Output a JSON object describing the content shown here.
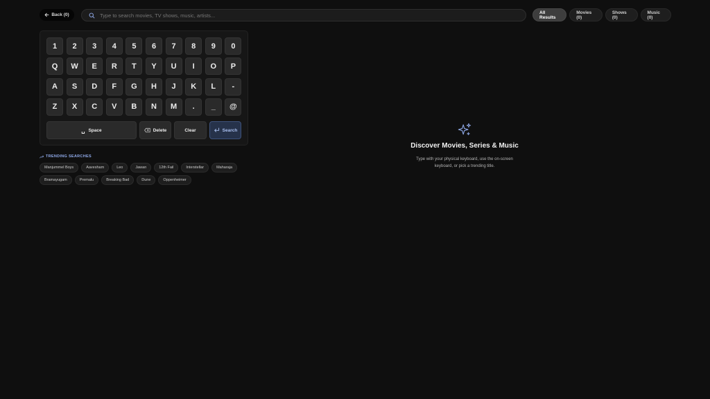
{
  "header": {
    "back_label": "Back (0)",
    "search_placeholder": "Type to search movies, TV shows, music, artists...",
    "search_value": "",
    "filters": [
      {
        "label": "All Results",
        "active": true
      },
      {
        "label": "Movies (0)",
        "active": false
      },
      {
        "label": "Shows (0)",
        "active": false
      },
      {
        "label": "Music (0)",
        "active": false
      }
    ]
  },
  "keyboard": {
    "rows": [
      [
        "1",
        "2",
        "3",
        "4",
        "5",
        "6",
        "7",
        "8",
        "9",
        "0"
      ],
      [
        "Q",
        "W",
        "E",
        "R",
        "T",
        "Y",
        "U",
        "I",
        "O",
        "P"
      ],
      [
        "A",
        "S",
        "D",
        "F",
        "G",
        "H",
        "J",
        "K",
        "L",
        "-"
      ],
      [
        "Z",
        "X",
        "C",
        "V",
        "B",
        "N",
        "M",
        ".",
        "_",
        "@"
      ]
    ],
    "space_label": "Space",
    "delete_label": "Delete",
    "clear_label": "Clear",
    "search_label": "Search"
  },
  "trending": {
    "title": "TRENDING SEARCHES",
    "items": [
      "Manjummel Boys",
      "Aavesham",
      "Leo",
      "Jawan",
      "12th Fail",
      "Interstellar",
      "Maharaja",
      "Bramayugam",
      "Premalu",
      "Breaking Bad",
      "Dune",
      "Oppenheimer"
    ]
  },
  "empty_state": {
    "icon": "sparkles-icon",
    "title": "Discover Movies, Series & Music",
    "text": "Type with your physical keyboard, use the on-screen keyboard, or pick a trending title."
  },
  "colors": {
    "background": "#0f0f0f",
    "accent": "#8fa9e8",
    "search_key_bg": "#26324a"
  }
}
